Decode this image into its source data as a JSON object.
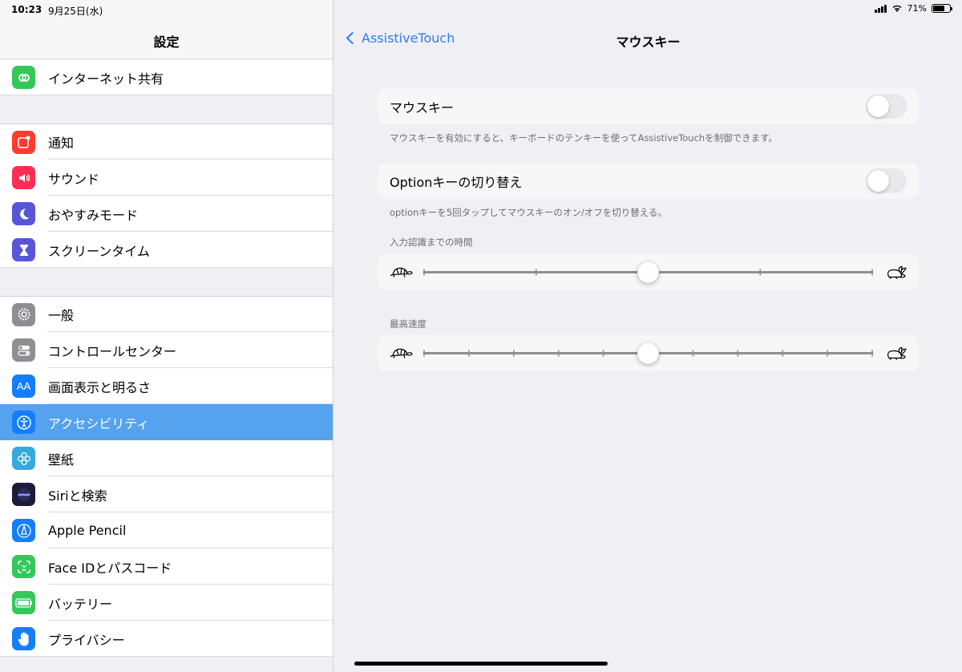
{
  "status": {
    "time": "10:23",
    "date": "9月25日(水)",
    "battery": "71%",
    "battery_level": 0.71
  },
  "sidebar": {
    "title": "設定",
    "groups": [
      [
        {
          "label": "インターネット共有",
          "icon": "hotspot-icon",
          "color": "#34c759"
        }
      ],
      [
        {
          "label": "通知",
          "icon": "notifications-icon",
          "color": "#ff3b30"
        },
        {
          "label": "サウンド",
          "icon": "speaker-icon",
          "color": "#ff2d55"
        },
        {
          "label": "おやすみモード",
          "icon": "moon-icon",
          "color": "#5856d6"
        },
        {
          "label": "スクリーンタイム",
          "icon": "hourglass-icon",
          "color": "#5856d6"
        }
      ],
      [
        {
          "label": "一般",
          "icon": "gear-icon",
          "color": "#8e8e93"
        },
        {
          "label": "コントロールセンター",
          "icon": "toggles-icon",
          "color": "#8e8e93"
        },
        {
          "label": "画面表示と明るさ",
          "icon": "text-size-icon",
          "color": "#147efb"
        },
        {
          "label": "アクセシビリティ",
          "icon": "accessibility-icon",
          "color": "#147efb",
          "selected": true
        },
        {
          "label": "壁紙",
          "icon": "flower-icon",
          "color": "#34aadc"
        },
        {
          "label": "Siriと検索",
          "icon": "siri-icon",
          "color": "#1c1c3a"
        },
        {
          "label": "Apple Pencil",
          "icon": "pencil-icon",
          "color": "#147efb"
        },
        {
          "label": "Face IDとパスコード",
          "icon": "face-id-icon",
          "color": "#34c759"
        },
        {
          "label": "バッテリー",
          "icon": "battery-icon",
          "color": "#34c759"
        },
        {
          "label": "プライバシー",
          "icon": "hand-icon",
          "color": "#147efb"
        }
      ]
    ]
  },
  "detail": {
    "back_label": "AssistiveTouch",
    "title": "マウスキー",
    "mouse_keys": {
      "label": "マウスキー",
      "on": false,
      "footnote": "マウスキーを有効にすると、キーボードのテンキーを使ってAssistiveTouchを制御できます。"
    },
    "option_key": {
      "label": "Optionキーの切り替え",
      "on": false,
      "footnote": "optionキーを5回タップしてマウスキーのオン/オフを切り替える。"
    },
    "initial_delay": {
      "label": "入力認識までの時間",
      "value": 0.5,
      "ticks": 5,
      "min_icon": "turtle-icon",
      "max_icon": "rabbit-icon"
    },
    "max_speed": {
      "label": "最高速度",
      "value": 0.5,
      "ticks": 11,
      "min_icon": "turtle-icon",
      "max_icon": "rabbit-icon"
    }
  },
  "colors": {
    "accent": "#2f7df6",
    "selected_row": "#55a2ee"
  }
}
